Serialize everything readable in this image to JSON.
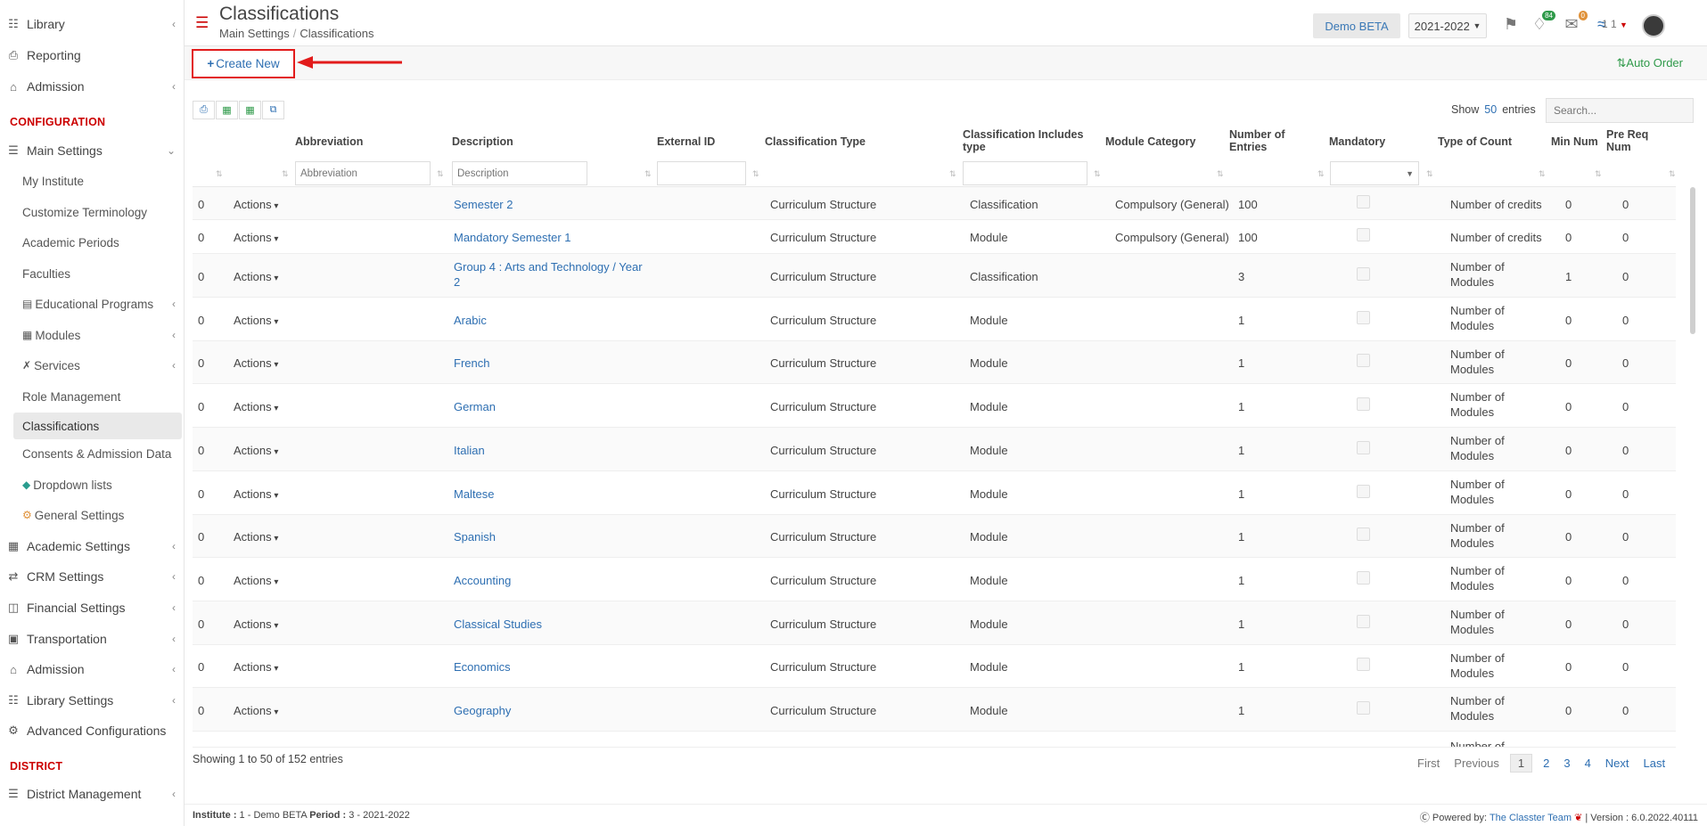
{
  "sidebar": {
    "top_items": [
      {
        "label": "Library",
        "icon": "books-icon",
        "chevron": true
      },
      {
        "label": "Reporting",
        "icon": "printer-icon",
        "chevron": false
      },
      {
        "label": "Admission",
        "icon": "bank-icon",
        "chevron": true
      }
    ],
    "section_configuration": "CONFIGURATION",
    "main_settings": {
      "label": "Main Settings",
      "icon": "sliders-icon"
    },
    "sub_items": [
      {
        "label": "My Institute"
      },
      {
        "label": "Customize Terminology"
      },
      {
        "label": "Academic Periods"
      },
      {
        "label": "Faculties"
      },
      {
        "label": "Educational Programs",
        "icon": "list-icon",
        "chevron": true
      },
      {
        "label": "Modules",
        "icon": "book-icon",
        "chevron": true
      },
      {
        "label": "Services",
        "icon": "tools-icon",
        "chevron": true
      },
      {
        "label": "Role Management"
      },
      {
        "label": "Classifications",
        "active": true
      },
      {
        "label": "Consents & Admission Data"
      },
      {
        "label": "Dropdown lists",
        "icon": "layers-icon"
      },
      {
        "label": "General Settings",
        "icon": "gears-icon"
      }
    ],
    "bottom_items": [
      {
        "label": "Academic Settings",
        "icon": "grid-icon",
        "chevron": true
      },
      {
        "label": "CRM Settings",
        "icon": "shuffle-icon",
        "chevron": true
      },
      {
        "label": "Financial Settings",
        "icon": "coins-icon",
        "chevron": true
      },
      {
        "label": "Transportation",
        "icon": "bus-icon",
        "chevron": true
      },
      {
        "label": "Admission",
        "icon": "bank-icon",
        "chevron": true
      },
      {
        "label": "Library Settings",
        "icon": "books-icon",
        "chevron": true
      },
      {
        "label": "Advanced Configurations",
        "icon": "cogs-icon",
        "chevron": false
      }
    ],
    "section_district": "DISTRICT",
    "district_item": {
      "label": "District Management",
      "icon": "menu-icon",
      "chevron": true
    }
  },
  "header": {
    "title": "Classifications",
    "breadcrumb": [
      "Main Settings",
      "Classifications"
    ],
    "demo_label": "Demo BETA",
    "year": "2021-2022",
    "notif_count": "84",
    "mail_count": "0",
    "user_num": "1 1"
  },
  "toolbar": {
    "create_new": "Create New",
    "auto_order": "Auto Order"
  },
  "table": {
    "show_label": "Show",
    "show_num": "50",
    "entries_label": "entries",
    "search_placeholder": "Search...",
    "headers": {
      "abbreviation": "Abbreviation",
      "description": "Description",
      "external_id": "External ID",
      "classification_type": "Classification Type",
      "includes_type_1": "Classification Includes",
      "includes_type_2": "type",
      "module_category": "Module Category",
      "number_entries_1": "Number of",
      "number_entries_2": "Entries",
      "mandatory": "Mandatory",
      "type_of_count": "Type of Count",
      "min_num": "Min Num",
      "pre_req_1": "Pre Req",
      "pre_req_2": "Num"
    },
    "filter_placeholders": {
      "abbreviation": "Abbreviation",
      "description": "Description"
    },
    "actions_label": "Actions",
    "rows": [
      {
        "order": "0",
        "desc1": "Semester 2",
        "desc2": "",
        "ctype": "Curriculum Structure",
        "includes": "Classification",
        "category": "Compulsory (General)",
        "entries": "100",
        "count1": "Number of credits",
        "count2": "",
        "min": "0",
        "prereq": "0"
      },
      {
        "order": "0",
        "desc1": "Mandatory Semester 1",
        "desc2": "",
        "ctype": "Curriculum Structure",
        "includes": "Module",
        "category": "Compulsory (General)",
        "entries": "100",
        "count1": "Number of credits",
        "count2": "",
        "min": "0",
        "prereq": "0"
      },
      {
        "order": "0",
        "desc1": "Group 4 : Arts and Technology / Year",
        "desc2": "2",
        "ctype": "Curriculum Structure",
        "includes": "Classification",
        "category": "",
        "entries": "3",
        "count1": "Number of",
        "count2": "Modules",
        "min": "1",
        "prereq": "0"
      },
      {
        "order": "0",
        "desc1": "Arabic",
        "desc2": "",
        "ctype": "Curriculum Structure",
        "includes": "Module",
        "category": "",
        "entries": "1",
        "count1": "Number of",
        "count2": "Modules",
        "min": "0",
        "prereq": "0"
      },
      {
        "order": "0",
        "desc1": "French",
        "desc2": "",
        "ctype": "Curriculum Structure",
        "includes": "Module",
        "category": "",
        "entries": "1",
        "count1": "Number of",
        "count2": "Modules",
        "min": "0",
        "prereq": "0"
      },
      {
        "order": "0",
        "desc1": "German",
        "desc2": "",
        "ctype": "Curriculum Structure",
        "includes": "Module",
        "category": "",
        "entries": "1",
        "count1": "Number of",
        "count2": "Modules",
        "min": "0",
        "prereq": "0"
      },
      {
        "order": "0",
        "desc1": "Italian",
        "desc2": "",
        "ctype": "Curriculum Structure",
        "includes": "Module",
        "category": "",
        "entries": "1",
        "count1": "Number of",
        "count2": "Modules",
        "min": "0",
        "prereq": "0"
      },
      {
        "order": "0",
        "desc1": "Maltese",
        "desc2": "",
        "ctype": "Curriculum Structure",
        "includes": "Module",
        "category": "",
        "entries": "1",
        "count1": "Number of",
        "count2": "Modules",
        "min": "0",
        "prereq": "0"
      },
      {
        "order": "0",
        "desc1": "Spanish",
        "desc2": "",
        "ctype": "Curriculum Structure",
        "includes": "Module",
        "category": "",
        "entries": "1",
        "count1": "Number of",
        "count2": "Modules",
        "min": "0",
        "prereq": "0"
      },
      {
        "order": "0",
        "desc1": "Accounting",
        "desc2": "",
        "ctype": "Curriculum Structure",
        "includes": "Module",
        "category": "",
        "entries": "1",
        "count1": "Number of",
        "count2": "Modules",
        "min": "0",
        "prereq": "0"
      },
      {
        "order": "0",
        "desc1": "Classical Studies",
        "desc2": "",
        "ctype": "Curriculum Structure",
        "includes": "Module",
        "category": "",
        "entries": "1",
        "count1": "Number of",
        "count2": "Modules",
        "min": "0",
        "prereq": "0"
      },
      {
        "order": "0",
        "desc1": "Economics",
        "desc2": "",
        "ctype": "Curriculum Structure",
        "includes": "Module",
        "category": "",
        "entries": "1",
        "count1": "Number of",
        "count2": "Modules",
        "min": "0",
        "prereq": "0"
      },
      {
        "order": "0",
        "desc1": "Geography",
        "desc2": "",
        "ctype": "Curriculum Structure",
        "includes": "Module",
        "category": "",
        "entries": "1",
        "count1": "Number of",
        "count2": "Modules",
        "min": "0",
        "prereq": "0"
      }
    ],
    "partial_row_count": "Number of",
    "showing": "Showing 1 to 50 of 152 entries",
    "pager": {
      "first": "First",
      "previous": "Previous",
      "pages": [
        "1",
        "2",
        "3",
        "4"
      ],
      "next": "Next",
      "last": "Last"
    }
  },
  "footer": {
    "institute_label": "Institute :",
    "institute_value": " 1 - Demo BETA ",
    "period_label": "Period :",
    "period_value": " 3 - 2021-2022",
    "powered_by": "Powered by: ",
    "team": "The Classter Team",
    "version": " | Version : 6.0.2022.40111"
  },
  "colors": {
    "accent_red": "#e21b1b",
    "link_blue": "#2e6fb2",
    "green": "#2f9a4a"
  }
}
